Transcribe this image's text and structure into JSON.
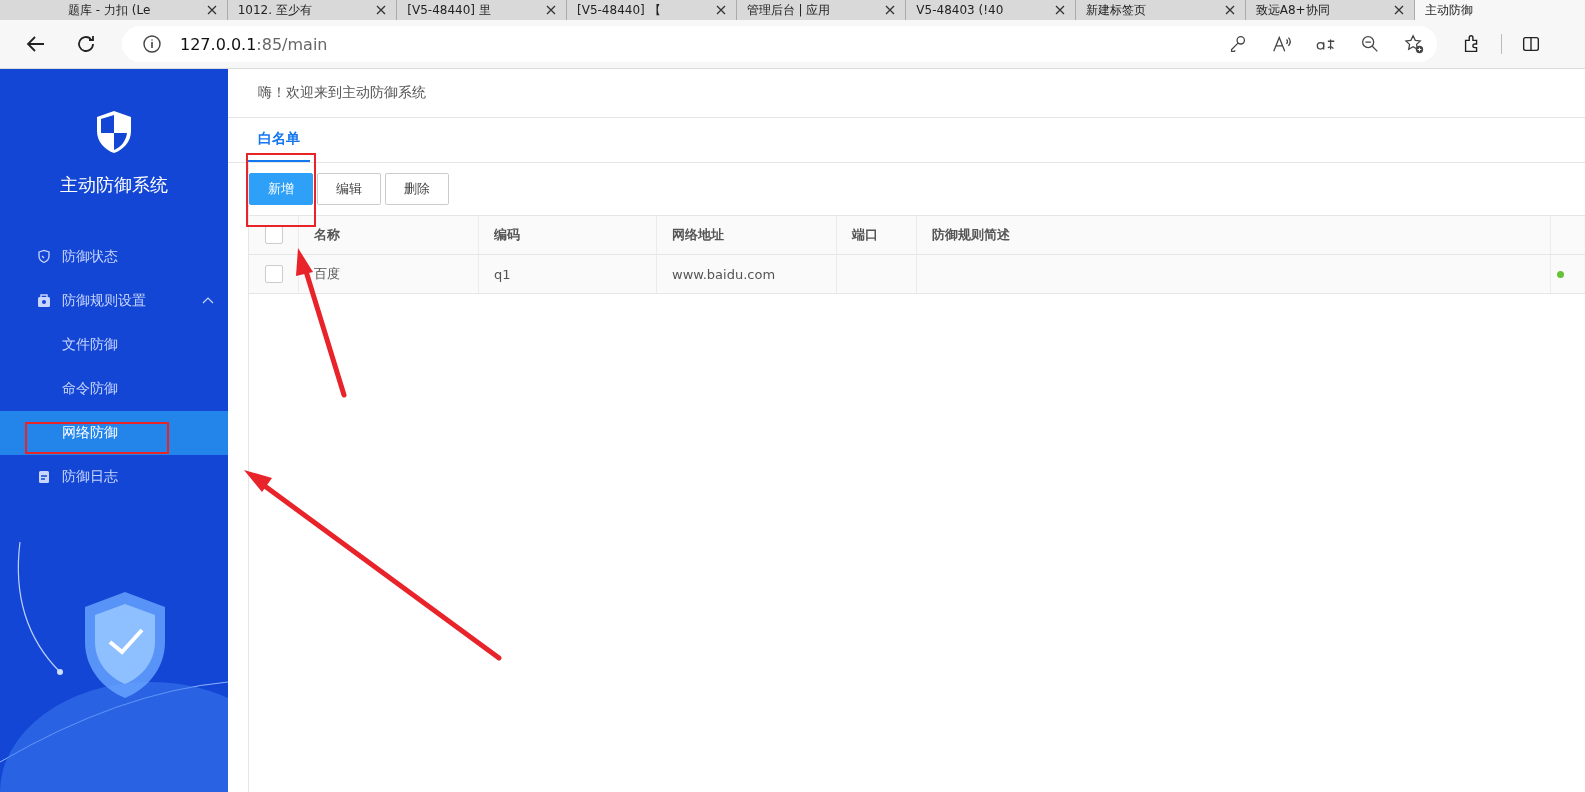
{
  "browser": {
    "tabs": [
      {
        "title": "题库 - 力扣 (Le",
        "selected": false
      },
      {
        "title": "1012. 至少有",
        "selected": false
      },
      {
        "title": "[V5-48440] 里",
        "selected": false
      },
      {
        "title": "[V5-48440] 【",
        "selected": false
      },
      {
        "title": "管理后台 | 应用",
        "selected": false
      },
      {
        "title": "V5-48403 (!40",
        "selected": false
      },
      {
        "title": "新建标签页",
        "selected": false
      },
      {
        "title": "致远A8+协同",
        "selected": false
      },
      {
        "title": "主动防御",
        "selected": true
      }
    ],
    "address": {
      "host": "127.0.0.1",
      "rest": ":85/main"
    }
  },
  "sidebar": {
    "title": "主动防御系统",
    "items": [
      {
        "label": "防御状态",
        "kind": "status",
        "selected": false
      },
      {
        "label": "防御规则设置",
        "kind": "rules",
        "expanded": true,
        "selected": false,
        "children": [
          {
            "label": "文件防御",
            "selected": false
          },
          {
            "label": "命令防御",
            "selected": false
          },
          {
            "label": "网络防御",
            "selected": true
          }
        ]
      },
      {
        "label": "防御日志",
        "kind": "log",
        "selected": false
      }
    ]
  },
  "header": {
    "greeting": "嗨！欢迎来到主动防御系统"
  },
  "tabs": [
    {
      "label": "白名单",
      "selected": true
    }
  ],
  "toolbar": [
    {
      "label": "新增",
      "kind": "primary"
    },
    {
      "label": "编辑",
      "kind": "default"
    },
    {
      "label": "删除",
      "kind": "default"
    }
  ],
  "table": {
    "columns": [
      "名称",
      "编码",
      "网络地址",
      "端口",
      "防御规则简述"
    ],
    "rows": [
      {
        "checked": false,
        "cells": [
          "百度",
          "q1",
          "www.baidu.com",
          "",
          ""
        ],
        "color": "#67c23a"
      }
    ],
    "header_checked": false
  }
}
